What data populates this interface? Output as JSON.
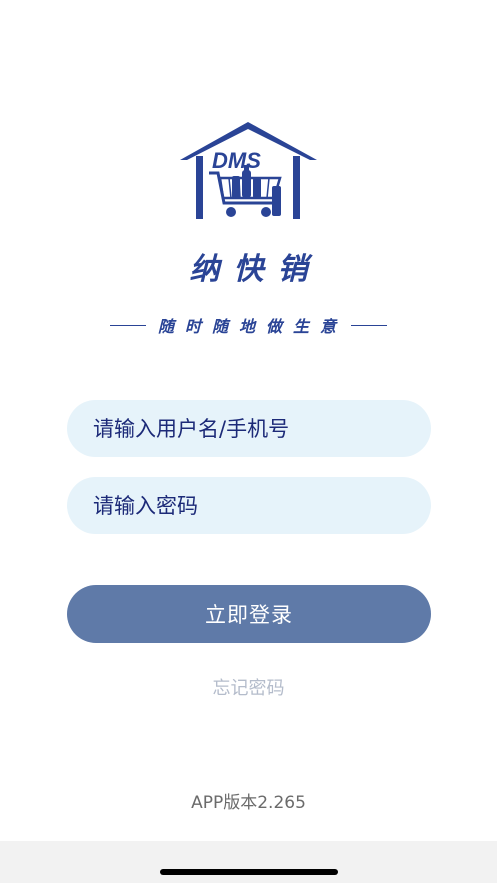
{
  "branding": {
    "logo_text": "DMS",
    "app_name": "纳快销",
    "slogan": "随时随地做生意",
    "brand_color": "#2a4496"
  },
  "login": {
    "username_placeholder": "请输入用户名/手机号",
    "password_placeholder": "请输入密码",
    "submit_label": "立即登录",
    "forgot_label": "忘记密码"
  },
  "footer": {
    "version_label": "APP版本2.265"
  },
  "colors": {
    "field_bg": "#e6f3fa",
    "button_bg": "#5f7aa8",
    "link_color": "#b4bccb"
  }
}
